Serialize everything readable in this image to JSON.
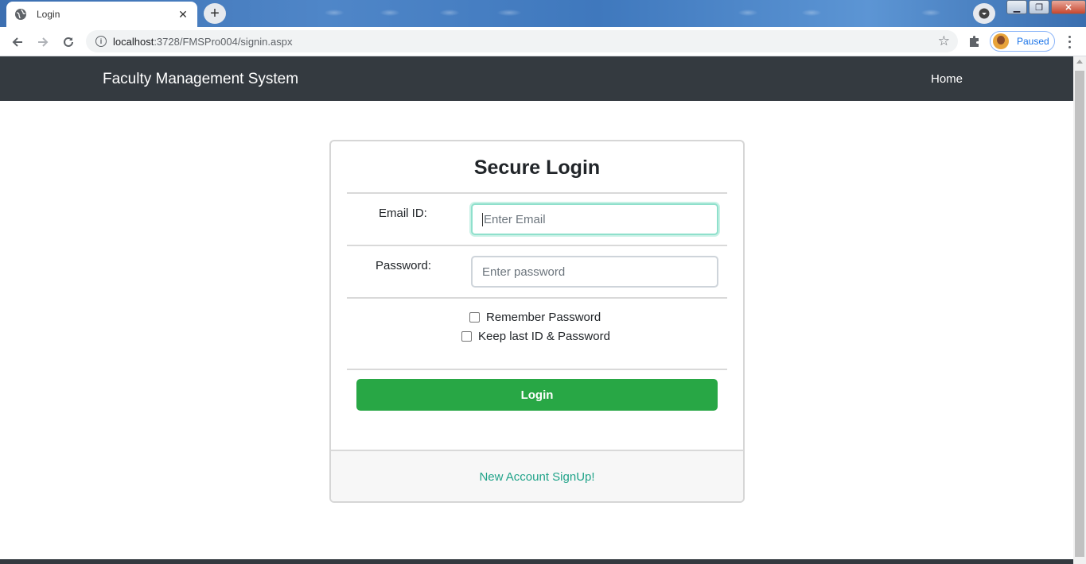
{
  "browser": {
    "tab_title": "Login",
    "url_host": "localhost",
    "url_path": ":3728/FMSPro004/signin.aspx",
    "profile_label": "Paused"
  },
  "navbar": {
    "brand": "Faculty Management System",
    "home_link": "Home",
    "background_color": "#343a40"
  },
  "login_card": {
    "heading": "Secure Login",
    "email_label": "Email ID:",
    "email_placeholder": "Enter Email",
    "password_label": "Password:",
    "password_placeholder": "Enter password",
    "remember_label": "Remember Password",
    "keep_label": "Keep last ID & Password",
    "login_button": "Login",
    "signup_link": "New Account SignUp!",
    "button_color": "#28a745",
    "link_color": "#20a389"
  },
  "icons": [
    "globe-icon",
    "close-icon",
    "plus-icon",
    "back-icon",
    "forward-icon",
    "reload-icon",
    "info-icon",
    "star-icon",
    "puzzle-icon",
    "kebab-menu-icon"
  ]
}
